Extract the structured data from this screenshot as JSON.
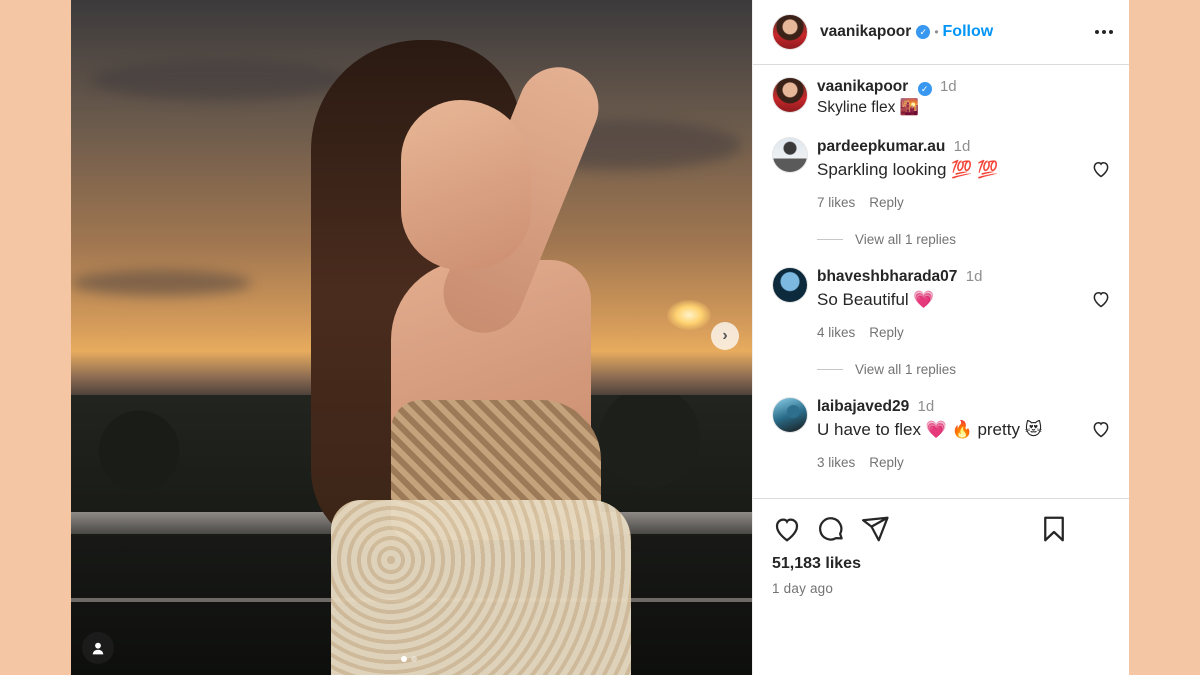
{
  "header": {
    "username": "vaanikapoor",
    "follow_label": "Follow",
    "separator": "•"
  },
  "caption": {
    "username": "vaanikapoor",
    "time": "1d",
    "text": "Skyline flex 🌇"
  },
  "comments": [
    {
      "username": "pardeepkumar.au",
      "time": "1d",
      "text": "Sparkling looking 💯 💯",
      "likes": "7 likes",
      "reply_label": "Reply",
      "view_replies": "View all 1 replies"
    },
    {
      "username": "bhaveshbharada07",
      "time": "1d",
      "text": "So Beautiful 💗",
      "likes": "4 likes",
      "reply_label": "Reply",
      "view_replies": "View all 1 replies"
    },
    {
      "username": "laibajaved29",
      "time": "1d",
      "text": "U have to flex 💗 🔥 pretty 😻",
      "likes": "3 likes",
      "reply_label": "Reply"
    }
  ],
  "footer": {
    "likes": "51,183 likes",
    "time_ago": "1 day ago"
  },
  "icons": {
    "like": "heart-icon",
    "comment": "comment-bubble-icon",
    "share": "paper-plane-icon",
    "save": "bookmark-icon",
    "next": "chevron-right-icon",
    "tag": "user-tag-icon",
    "more": "more-horizontal-icon"
  },
  "colors": {
    "follow": "#0095f6",
    "verified": "#3897f0",
    "page_background": "#f5c6a4"
  }
}
